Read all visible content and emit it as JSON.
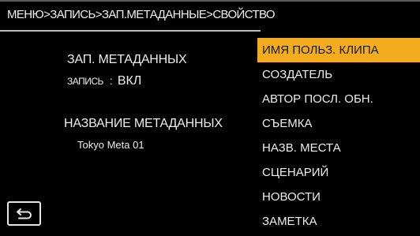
{
  "header": {
    "breadcrumb": "МЕНЮ>ЗАПИСЬ>ЗАП.МЕТАДАННЫЕ>СВОЙСТВО"
  },
  "info": {
    "metadata_record_title": "ЗАП. МЕТАДАННЫХ",
    "record_label": "ЗАПИСЬ",
    "record_separator": ":",
    "record_value": "ВКЛ",
    "metadata_name_title": "НАЗВАНИЕ МЕТАДАННЫХ",
    "metadata_name_value": "Tokyo Meta 01"
  },
  "menu": {
    "selected_index": 0,
    "items": [
      {
        "label": "ИМЯ ПОЛЬЗ. КЛИПА"
      },
      {
        "label": "СОЗДАТЕЛЬ"
      },
      {
        "label": "АВТОР ПОСЛ. ОБН."
      },
      {
        "label": "СЪЕМКА"
      },
      {
        "label": "НАЗВ. МЕСТА"
      },
      {
        "label": "СЦЕНАРИЙ"
      },
      {
        "label": "НОВОСТИ"
      },
      {
        "label": "ЗАМЕТКА"
      }
    ]
  },
  "back_button": {
    "icon": "return-arrow-icon"
  },
  "colors": {
    "background": "#000000",
    "selected": "#f2ac1d",
    "text": "#eeeeee"
  }
}
